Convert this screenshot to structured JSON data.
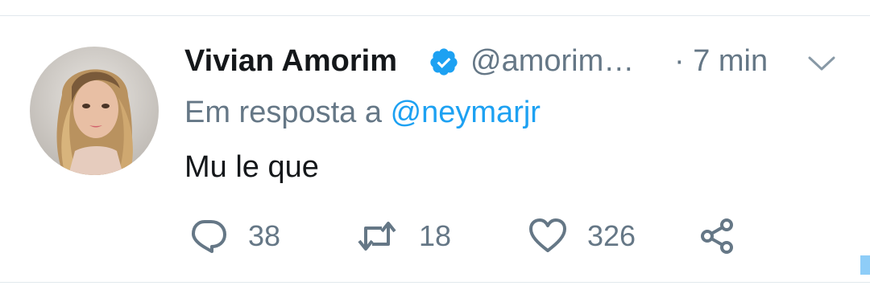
{
  "tweet": {
    "display_name": "Vivian Amorim",
    "verified": true,
    "handle": "@amorim…",
    "timestamp": "· 7 min",
    "reply_prefix": "Em resposta a",
    "reply_to": "@neymarjr",
    "text": "Mu le que",
    "actions": {
      "reply_count": "38",
      "retweet_count": "18",
      "like_count": "326"
    }
  },
  "colors": {
    "primary_text": "#14171a",
    "secondary_text": "#657786",
    "accent": "#1da1f2",
    "divider": "#e1e8ed"
  },
  "icons": [
    "verified-badge-icon",
    "chevron-down-icon",
    "reply-icon",
    "retweet-icon",
    "like-icon",
    "share-icon"
  ]
}
